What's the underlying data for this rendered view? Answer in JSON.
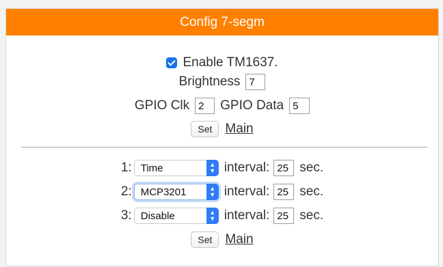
{
  "panel": {
    "title": "Config 7-segm"
  },
  "display": {
    "enable_label": "Enable TM1637.",
    "enable_checked": true,
    "brightness_label": "Brightness",
    "brightness_value": "7",
    "gpio_clk_label": "GPIO Clk",
    "gpio_clk_value": "2",
    "gpio_data_label": "GPIO Data",
    "gpio_data_value": "5",
    "set_label": "Set",
    "main_link": "Main"
  },
  "slots": [
    {
      "index": "1:",
      "source": "Time",
      "interval_label": "interval:",
      "interval": "25",
      "unit": "sec."
    },
    {
      "index": "2:",
      "source": "MCP3201",
      "interval_label": "interval:",
      "interval": "25",
      "unit": "sec."
    },
    {
      "index": "3:",
      "source": "Disable",
      "interval_label": "interval:",
      "interval": "25",
      "unit": "sec."
    }
  ],
  "slots_actions": {
    "set_label": "Set",
    "main_link": "Main"
  },
  "colors": {
    "header_bg": "#ff8000",
    "checkbox": "#1a73e8",
    "select_chevron": "#2f7cf6"
  }
}
